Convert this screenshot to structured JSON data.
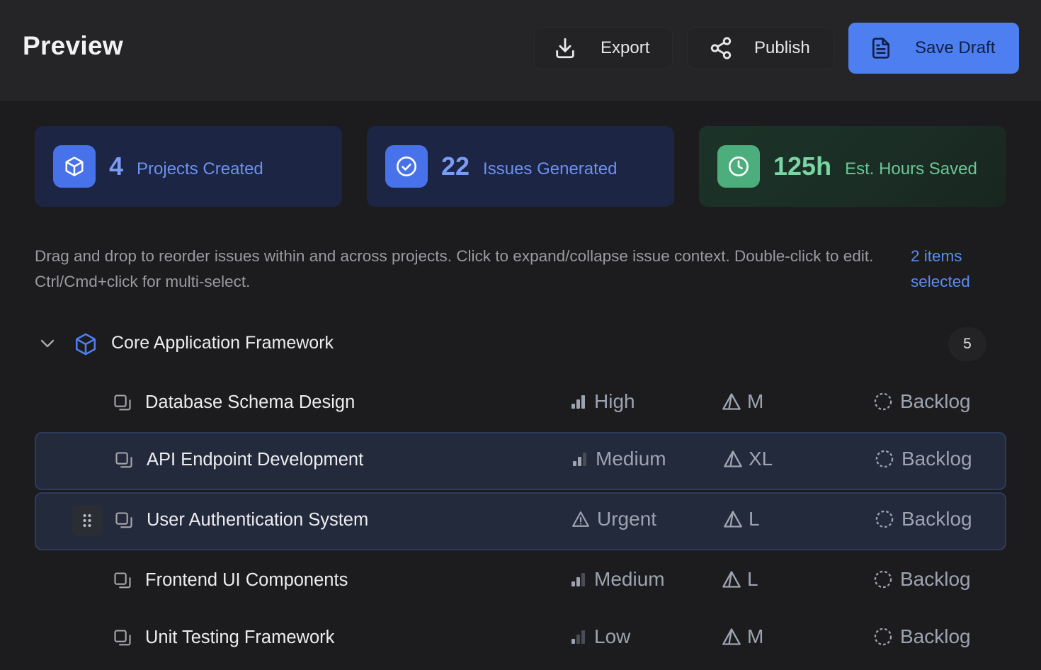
{
  "header": {
    "title": "Preview",
    "export_label": "Export",
    "publish_label": "Publish",
    "save_label": "Save Draft"
  },
  "stats": [
    {
      "value": "4",
      "label": "Projects Created",
      "icon": "cube-icon"
    },
    {
      "value": "22",
      "label": "Issues Generated",
      "icon": "check-circle-icon"
    },
    {
      "value": "125h",
      "label": "Est. Hours Saved",
      "icon": "clock-icon"
    }
  ],
  "help": {
    "text": "Drag and drop to reorder issues within and across projects. Click to expand/collapse issue context. Double-click to edit. Ctrl/Cmd+click for multi-select.",
    "selected": "2 items selected"
  },
  "project": {
    "name": "Core Application Framework",
    "count": "5",
    "expanded": true
  },
  "issues": [
    {
      "name": "Database Schema Design",
      "priority": "High",
      "estimate": "M",
      "status": "Backlog",
      "selected": false
    },
    {
      "name": "API Endpoint Development",
      "priority": "Medium",
      "estimate": "XL",
      "status": "Backlog",
      "selected": true
    },
    {
      "name": "User Authentication System",
      "priority": "Urgent",
      "estimate": "L",
      "status": "Backlog",
      "selected": true
    },
    {
      "name": "Frontend UI Components",
      "priority": "Medium",
      "estimate": "L",
      "status": "Backlog",
      "selected": false
    },
    {
      "name": "Unit Testing Framework",
      "priority": "Low",
      "estimate": "M",
      "status": "Backlog",
      "selected": false
    }
  ],
  "colors": {
    "accent": "#4d7ff0",
    "success": "#4cae7c",
    "background": "#1c1c1e"
  }
}
